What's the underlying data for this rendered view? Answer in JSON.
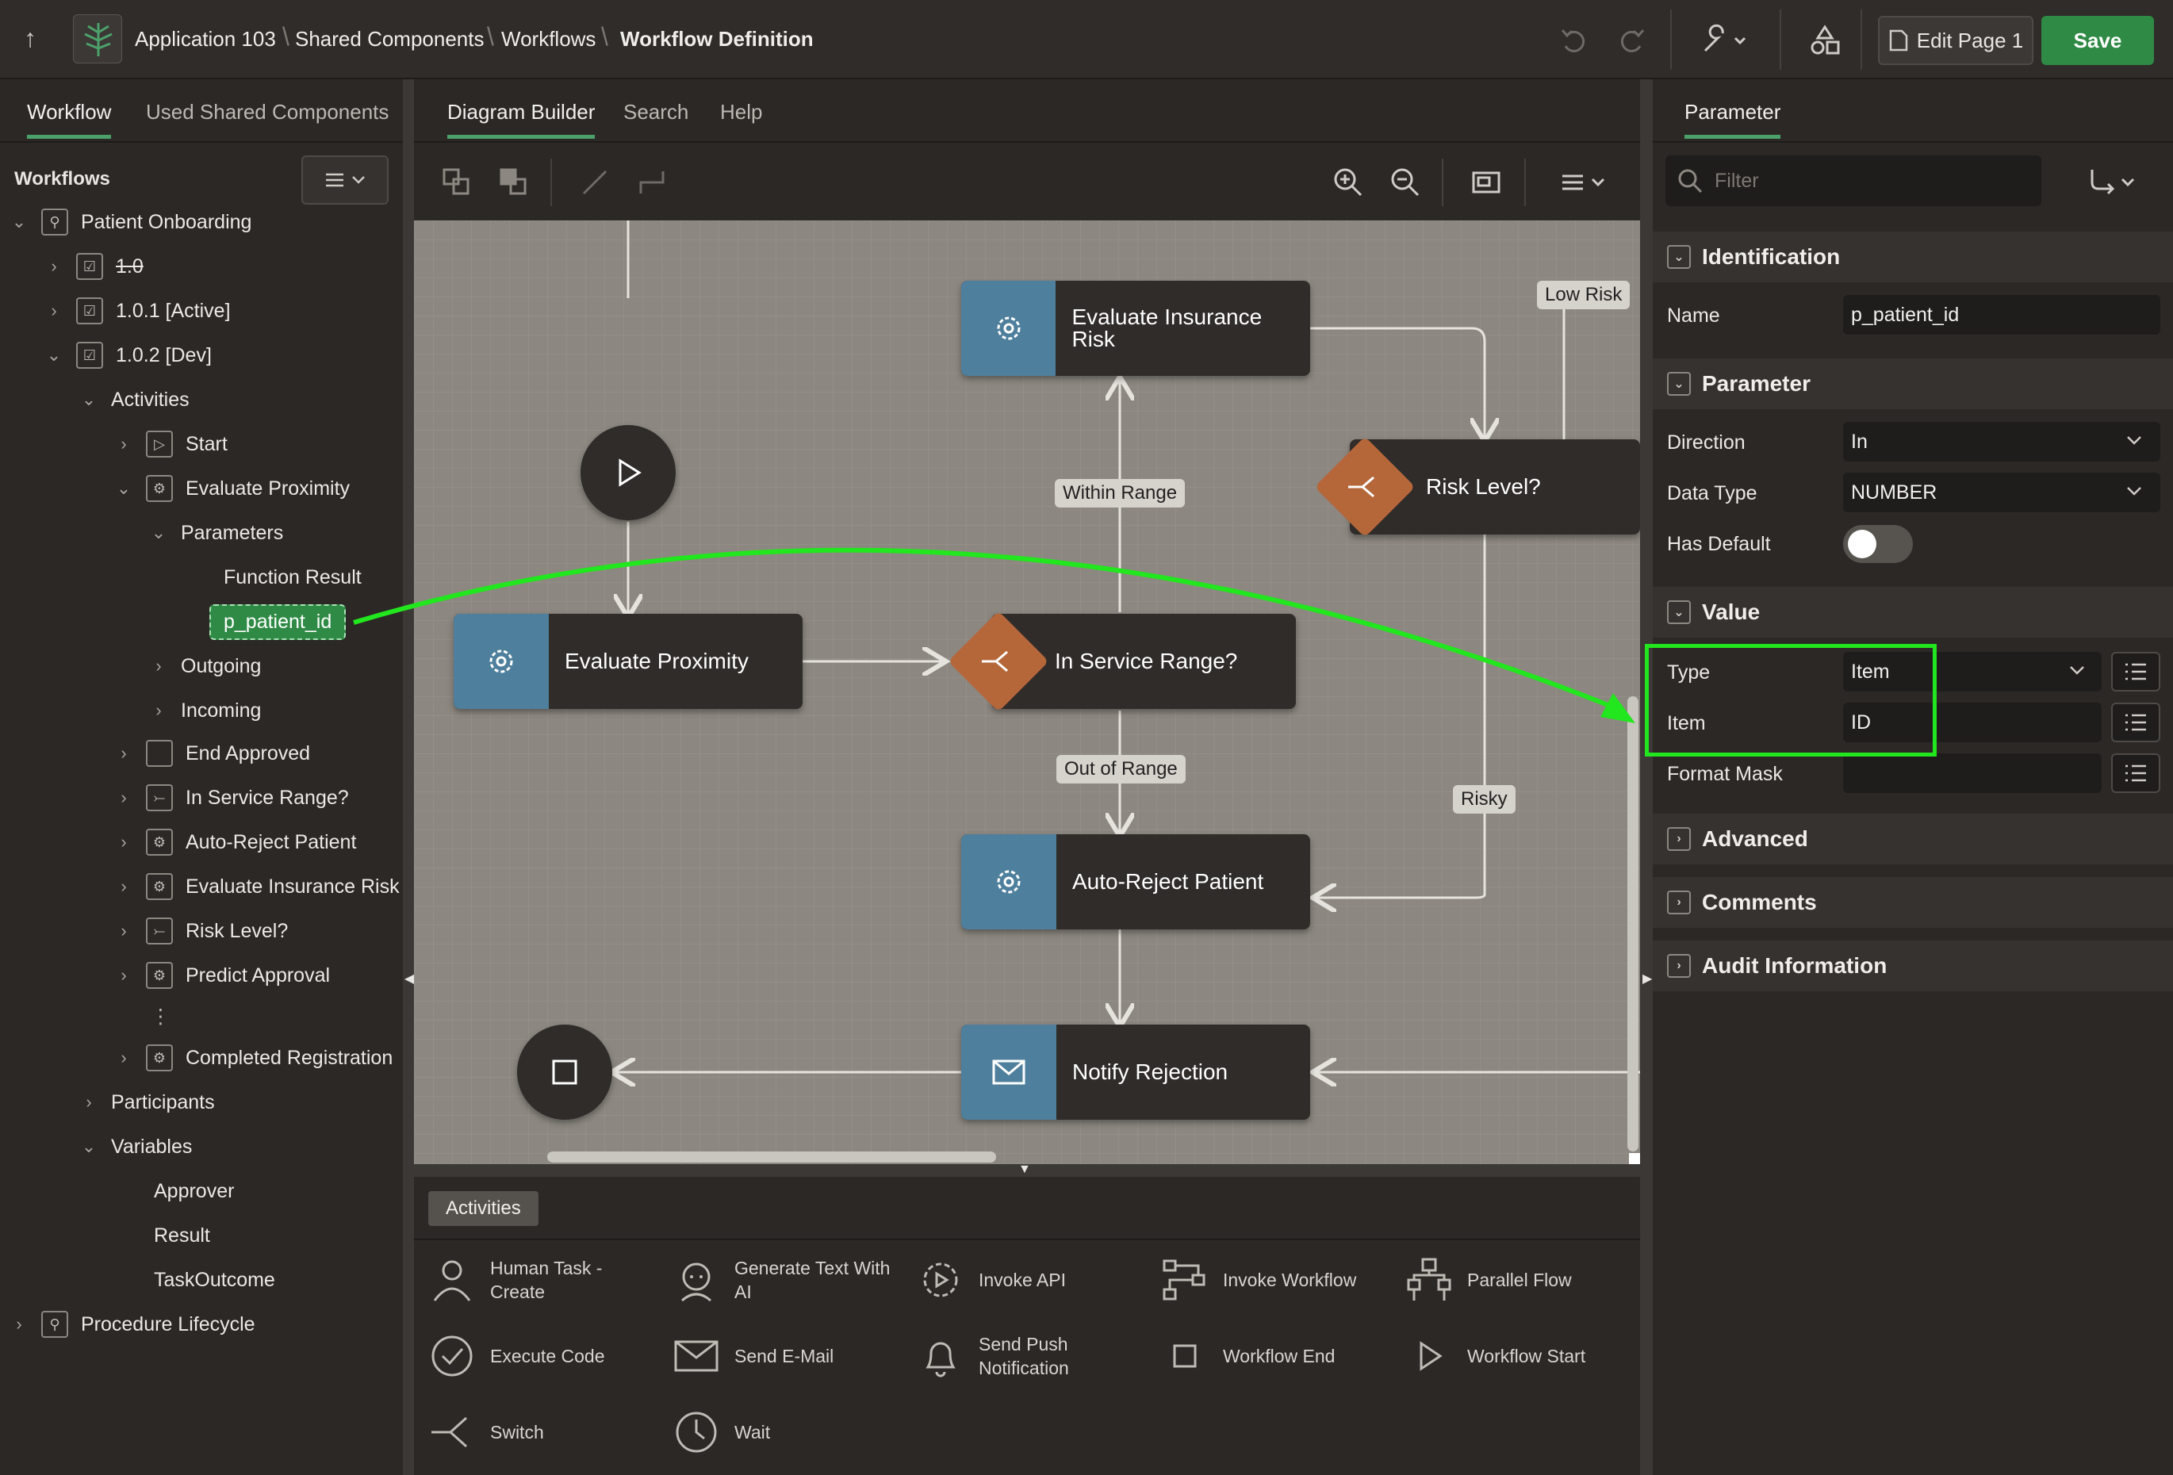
{
  "header": {
    "breadcrumb": [
      "Application 103",
      "Shared Components",
      "Workflows",
      "Workflow Definition"
    ],
    "edit_page_label": "Edit Page 1",
    "save_label": "Save"
  },
  "left_panel": {
    "tabs": [
      "Workflow",
      "Used Shared Components"
    ],
    "section_title": "Workflows",
    "tree": {
      "patient_onboarding": "Patient Onboarding",
      "v10": "1.0",
      "v101": "1.0.1 [Active]",
      "v102": "1.0.2 [Dev]",
      "activities": "Activities",
      "start": "Start",
      "evaluate_proximity": "Evaluate Proximity",
      "parameters": "Parameters",
      "function_result": "Function Result",
      "p_patient_id": "p_patient_id",
      "outgoing": "Outgoing",
      "incoming": "Incoming",
      "end_approved": "End Approved",
      "in_service_range": "In Service Range?",
      "auto_reject": "Auto-Reject Patient",
      "evaluate_insurance": "Evaluate Insurance Risk",
      "risk_level": "Risk Level?",
      "predict_approval": "Predict Approval",
      "ellipsis": "⋮",
      "completed_registration": "Completed Registration",
      "participants": "Participants",
      "variables": "Variables",
      "approver": "Approver",
      "result": "Result",
      "task_outcome": "TaskOutcome",
      "procedure_lifecycle": "Procedure Lifecycle"
    }
  },
  "center_panel": {
    "tabs": [
      "Diagram Builder",
      "Search",
      "Help"
    ],
    "diagram": {
      "nodes": {
        "evaluate_insurance": "Evaluate Insurance Risk",
        "risk_level": "Risk Level?",
        "evaluate_proximity": "Evaluate Proximity",
        "in_service_range": "In Service Range?",
        "auto_reject": "Auto-Reject Patient",
        "notify_rejection": "Notify Rejection"
      },
      "edge_labels": {
        "low_risk": "Low Risk",
        "within_range": "Within Range",
        "out_of_range": "Out of Range",
        "risky": "Risky"
      }
    },
    "palette": {
      "tab_label": "Activities",
      "items": [
        "Human Task - Create",
        "Generate Text With AI",
        "Invoke API",
        "Invoke Workflow",
        "Parallel Flow",
        "Execute Code",
        "Send E-Mail",
        "Send Push Notification",
        "Workflow End",
        "Workflow Start",
        "Switch",
        "Wait"
      ]
    }
  },
  "right_panel": {
    "tab": "Parameter",
    "filter_placeholder": "Filter",
    "groups": {
      "identification": "Identification",
      "parameter": "Parameter",
      "value": "Value",
      "advanced": "Advanced",
      "comments": "Comments",
      "audit": "Audit Information"
    },
    "fields": {
      "name_label": "Name",
      "name_value": "p_patient_id",
      "direction_label": "Direction",
      "direction_value": "In",
      "data_type_label": "Data Type",
      "data_type_value": "NUMBER",
      "has_default_label": "Has Default",
      "type_label": "Type",
      "type_value": "Item",
      "item_label": "Item",
      "item_value": "ID",
      "format_mask_label": "Format Mask"
    }
  },
  "colors": {
    "accent_green": "#2f8a45",
    "highlight_green": "#22e61e",
    "node_blue": "#4e7f9c",
    "switch_orange": "#b5673a"
  }
}
